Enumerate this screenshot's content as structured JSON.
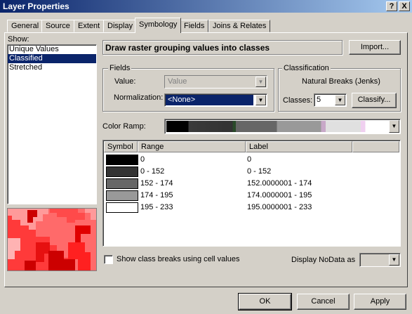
{
  "window": {
    "title": "Layer Properties",
    "help_button": "?",
    "close_button": "X"
  },
  "tabs": [
    {
      "label": "General"
    },
    {
      "label": "Source"
    },
    {
      "label": "Extent"
    },
    {
      "label": "Display"
    },
    {
      "label": "Symbology",
      "active": true
    },
    {
      "label": "Fields"
    },
    {
      "label": "Joins & Relates"
    }
  ],
  "show": {
    "label": "Show:",
    "items": [
      "Unique Values",
      "Classified",
      "Stretched"
    ],
    "selected": "Classified"
  },
  "header": {
    "description": "Draw raster grouping values into classes",
    "import_button": "Import..."
  },
  "fields": {
    "group_label": "Fields",
    "value_label": "Value:",
    "value_selected": "Value",
    "normalization_label": "Normalization:",
    "normalization_selected": "<None>"
  },
  "classification": {
    "group_label": "Classification",
    "method": "Natural Breaks (Jenks)",
    "classes_label": "Classes:",
    "classes_value": "5",
    "classify_button": "Classify..."
  },
  "color_ramp": {
    "label": "Color Ramp:"
  },
  "symbol_table": {
    "columns": [
      "Symbol",
      "Range",
      "Label"
    ],
    "rows": [
      {
        "color": "#000000",
        "range": "0",
        "label": "0"
      },
      {
        "color": "#333333",
        "range": "0 - 152",
        "label": "0 - 152"
      },
      {
        "color": "#666666",
        "range": "152 - 174",
        "label": "152.0000001 - 174"
      },
      {
        "color": "#999999",
        "range": "174 - 195",
        "label": "174.0000001 - 195"
      },
      {
        "color": "#ffffff",
        "range": "195 - 233",
        "label": "195.0000001 - 233"
      }
    ]
  },
  "options": {
    "show_class_breaks_label": "Show class breaks using cell values",
    "show_class_breaks_checked": false,
    "display_nodata_label": "Display NoData as"
  },
  "footer": {
    "ok_button": "OK",
    "cancel_button": "Cancel",
    "apply_button": "Apply"
  }
}
